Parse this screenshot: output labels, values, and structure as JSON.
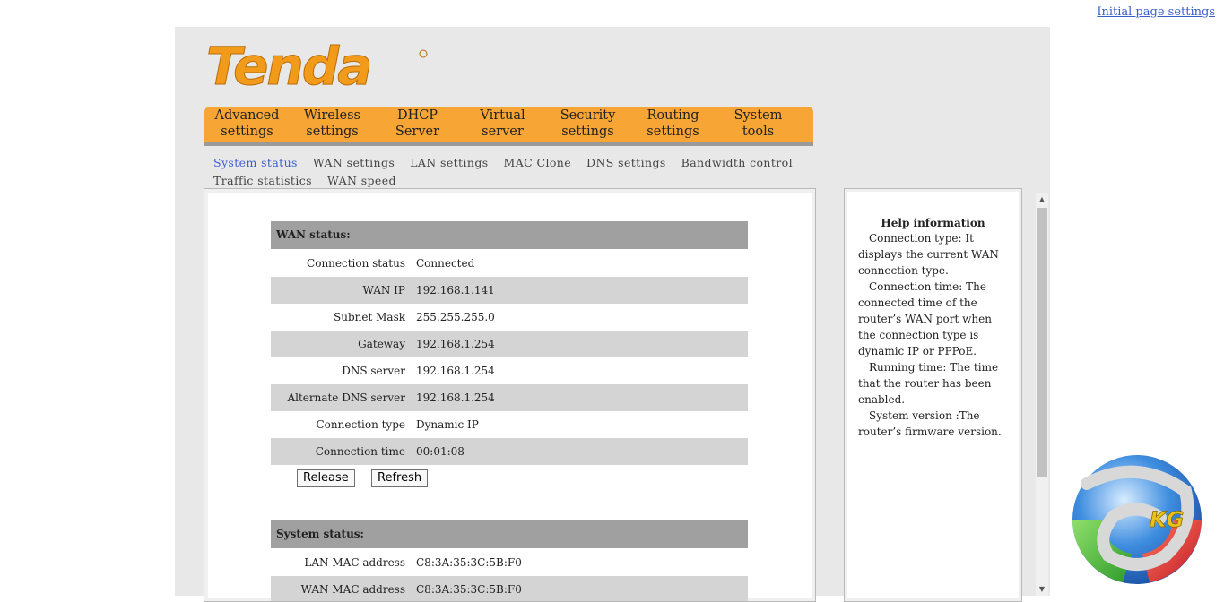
{
  "top_link": "Initial page settings",
  "brand": "Tenda",
  "nav": [
    {
      "l1": "Advanced",
      "l2": "settings"
    },
    {
      "l1": "Wireless",
      "l2": "settings"
    },
    {
      "l1": "DHCP",
      "l2": "Server"
    },
    {
      "l1": "Virtual",
      "l2": "server"
    },
    {
      "l1": "Security",
      "l2": "settings"
    },
    {
      "l1": "Routing",
      "l2": "settings"
    },
    {
      "l1": "System",
      "l2": "tools"
    }
  ],
  "subnav": [
    "System status",
    "WAN settings",
    "LAN settings",
    "MAC Clone",
    "DNS settings",
    "Bandwidth control",
    "Traffic statistics",
    "WAN speed"
  ],
  "wan": {
    "title": "WAN status:",
    "rows": [
      {
        "label": "Connection status",
        "value": "Connected"
      },
      {
        "label": "WAN IP",
        "value": "192.168.1.141"
      },
      {
        "label": "Subnet Mask",
        "value": "255.255.255.0"
      },
      {
        "label": "Gateway",
        "value": "192.168.1.254"
      },
      {
        "label": "DNS server",
        "value": "192.168.1.254"
      },
      {
        "label": "Alternate DNS server",
        "value": "192.168.1.254"
      },
      {
        "label": "Connection type",
        "value": "Dynamic IP"
      },
      {
        "label": "Connection time",
        "value": "00:01:08"
      }
    ],
    "release_label": "Release",
    "refresh_label": "Refresh"
  },
  "system": {
    "title": "System status:",
    "rows": [
      {
        "label": "LAN MAC address",
        "value": "C8:3A:35:3C:5B:F0"
      },
      {
        "label": "WAN MAC address",
        "value": "C8:3A:35:3C:5B:F0"
      }
    ]
  },
  "help": {
    "title": "Help information",
    "paragraphs": [
      "Connection type: It displays the current WAN connection type.",
      "Connection time: The connected time of the router’s WAN port when the connection type is dynamic IP or PPPoE.",
      "Running time: The time that the router has been enabled.",
      "System version :The router’s firmware version."
    ]
  },
  "watermark": "KG",
  "colors": {
    "nav_bg": "#f7a534",
    "brand_orange": "#f29a1a",
    "link": "#3a5fcd"
  }
}
